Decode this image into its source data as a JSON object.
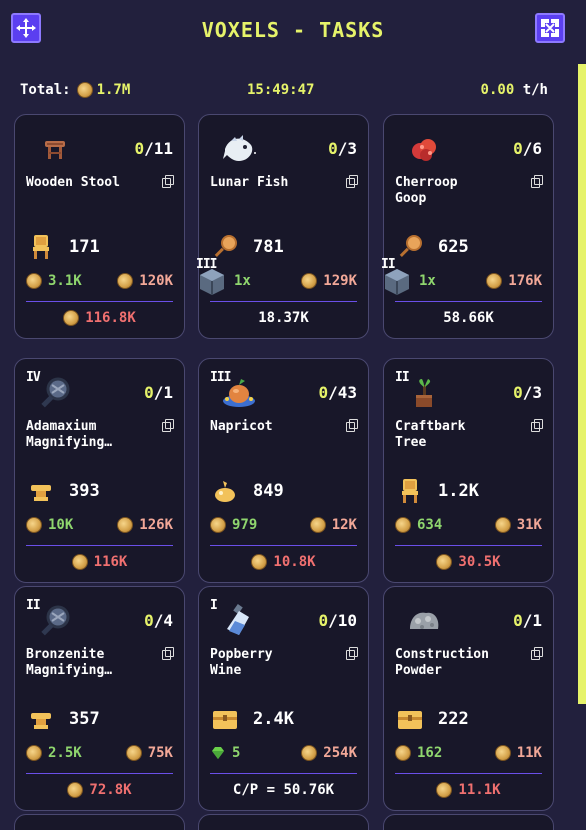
{
  "header": {
    "title": "VOXELS - TASKS",
    "left_icon": "move-icon",
    "right_icon": "close-icon"
  },
  "stats": {
    "total_label": "Total:",
    "total_value": "1.7M",
    "clock": "15:49:47",
    "rate_value": "0.00",
    "rate_unit": "t/h"
  },
  "colors": {
    "accent": "#e6f36a",
    "button": "#5b3ff0",
    "green": "#8fd66e",
    "pink": "#f2a898",
    "red": "#f07070"
  },
  "cards": [
    {
      "tier": "",
      "icon": "stool-icon",
      "done": "0",
      "total": "/11",
      "name": "Wooden Stool",
      "req_icon": "chair-icon",
      "req_value": "171",
      "reward_left": "3.1K",
      "reward_right": "120K",
      "foot": "116.8K"
    },
    {
      "tier": "",
      "icon": "fish-icon",
      "done": "0",
      "total": "/3",
      "name": "Lunar Fish",
      "req_icon": "rod-icon",
      "req_value": "781",
      "special_tier": "III",
      "special_count": "1x",
      "reward_right": "129K",
      "foot": "18.37K"
    },
    {
      "tier": "",
      "icon": "goop-icon",
      "done": "0",
      "total": "/6",
      "name": "Cherroop\nGoop",
      "req_icon": "rod-icon",
      "req_value": "625",
      "special_tier": "II",
      "special_count": "1x",
      "reward_right": "176K",
      "foot": "58.66K"
    },
    {
      "tier": "IV",
      "icon": "magnifier-icon",
      "done": "0",
      "total": "/1",
      "name": "Adamaxium\nMagnifying…",
      "req_icon": "anvil-icon",
      "req_value": "393",
      "reward_left": "10K",
      "reward_right": "126K",
      "foot": "116K"
    },
    {
      "tier": "III",
      "icon": "napricot-icon",
      "done": "0",
      "total": "/43",
      "name": "Napricot",
      "req_icon": "sprout-icon",
      "req_value": "849",
      "reward_left": "979",
      "reward_right": "12K",
      "foot": "10.8K"
    },
    {
      "tier": "II",
      "icon": "tree-icon",
      "done": "0",
      "total": "/3",
      "name": "Craftbark\nTree",
      "req_icon": "chair-icon",
      "req_value": "1.2K",
      "reward_left": "634",
      "reward_right": "31K",
      "foot": "30.5K"
    },
    {
      "tier": "II",
      "icon": "magnifier-icon",
      "done": "0",
      "total": "/4",
      "name": "Bronzenite\nMagnifying…",
      "req_icon": "anvil-icon",
      "req_value": "357",
      "reward_left": "2.5K",
      "reward_right": "75K",
      "foot": "72.8K"
    },
    {
      "tier": "I",
      "icon": "bottle-icon",
      "done": "0",
      "total": "/10",
      "name": "Popberry\nWine",
      "req_icon": "chest-icon",
      "req_value": "2.4K",
      "gem_value": "5",
      "reward_right": "254K",
      "foot": "C/P = 50.76K"
    },
    {
      "tier": "",
      "icon": "rock-icon",
      "done": "0",
      "total": "/1",
      "name": "Construction\nPowder",
      "req_icon": "chest-icon",
      "req_value": "222",
      "reward_left": "162",
      "reward_right": "11K",
      "foot": "11.1K"
    }
  ]
}
